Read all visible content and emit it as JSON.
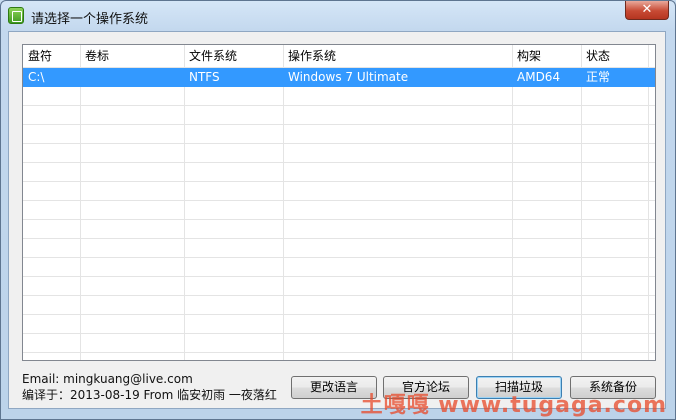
{
  "window": {
    "title": "请选择一个操作系统",
    "close_glyph": "✕"
  },
  "table": {
    "columns": [
      "盘符",
      "卷标",
      "文件系统",
      "操作系统",
      "构架",
      "状态"
    ],
    "rows": [
      {
        "drive": "C:\\",
        "label": "",
        "fs": "NTFS",
        "os": "Windows 7 Ultimate",
        "arch": "AMD64",
        "status": "正常"
      }
    ]
  },
  "footer": {
    "email": "Email: mingkuang@live.com",
    "compiled": "编译于：2013-08-19 From 临安初雨 一夜落红"
  },
  "buttons": {
    "language": "更改语言",
    "forum": "官方论坛",
    "scan": "扫描垃圾",
    "backup": "系统备份"
  },
  "watermark": "土嘎嘎 www.tugaga.com",
  "colors": {
    "selection": "#3399ff",
    "close": "#c74a34"
  }
}
